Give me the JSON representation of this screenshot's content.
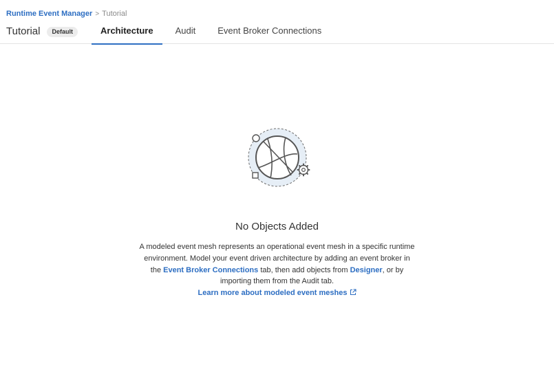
{
  "breadcrumb": {
    "parent": "Runtime Event Manager",
    "separator": ">",
    "current": "Tutorial"
  },
  "header": {
    "title": "Tutorial",
    "badge": "Default"
  },
  "tabs": [
    {
      "label": "Architecture",
      "active": true
    },
    {
      "label": "Audit",
      "active": false
    },
    {
      "label": "Event Broker Connections",
      "active": false
    }
  ],
  "empty_state": {
    "illustration_icon": "globe-icon",
    "title": "No Objects Added",
    "desc_part1": "A modeled event mesh represents an operational event mesh in a specific runtime environment. Model your event driven architecture by adding an event broker in the ",
    "desc_link1": "Event Broker Connections",
    "desc_part2": " tab, then add objects from ",
    "desc_link2": "Designer",
    "desc_part3": ", or by importing them from the Audit tab.",
    "learn_more": "Learn more about modeled event meshes",
    "learn_more_icon": "external-link-icon"
  },
  "colors": {
    "accent": "#2d6ec2",
    "badge_bg": "#ececec",
    "illustration_bg": "#e6eef6"
  }
}
